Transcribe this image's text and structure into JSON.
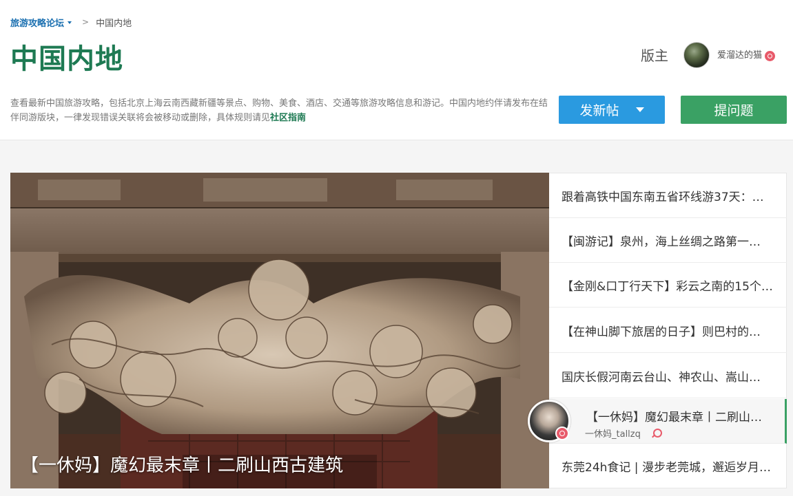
{
  "breadcrumb": {
    "forum": "旅游攻略论坛",
    "separator": ">",
    "current": "中国内地"
  },
  "header": {
    "title": "中国内地",
    "moderator_label": "版主",
    "moderator_name": "爱溜达的猫",
    "description": "查看最新中国旅游攻略，包括北京上海云南西藏新疆等景点、购物、美食、酒店、交通等旅游攻略信息和游记。中国内地约伴请发布在结伴同游版块，一律发现错误关联将会被移动或删除，具体规则请见",
    "guide_link": "社区指南"
  },
  "actions": {
    "post_label": "发新帖",
    "ask_label": "提问题"
  },
  "featured": {
    "caption": "【一休妈】魔幻最末章丨二刷山西古建筑",
    "author": "一休妈_tallzq"
  },
  "side_list": [
    {
      "title": "跟着高铁中国东南五省环线游37天：…"
    },
    {
      "title": "【闽游记】泉州，海上丝绸之路第一…"
    },
    {
      "title": "【金刚&口丁行天下】彩云之南的15个…"
    },
    {
      "title": "【在神山脚下旅居的日子】则巴村的…"
    },
    {
      "title": "国庆长假河南云台山、神农山、嵩山…"
    },
    {
      "title": "【一休妈】魔幻最末章丨二刷山…"
    },
    {
      "title": "东莞24h食记 | 漫步老莞城，邂逅岁月…"
    }
  ],
  "icons": {
    "badge": "verified-badge-icon",
    "caret": "caret-down-icon",
    "pin": "location-pin-icon"
  },
  "colors": {
    "title_green": "#1e7a53",
    "post_blue": "#2a9ae0",
    "ask_green": "#3aa164",
    "link_blue": "#1a6fb0",
    "badge_red": "#e85a6a"
  }
}
